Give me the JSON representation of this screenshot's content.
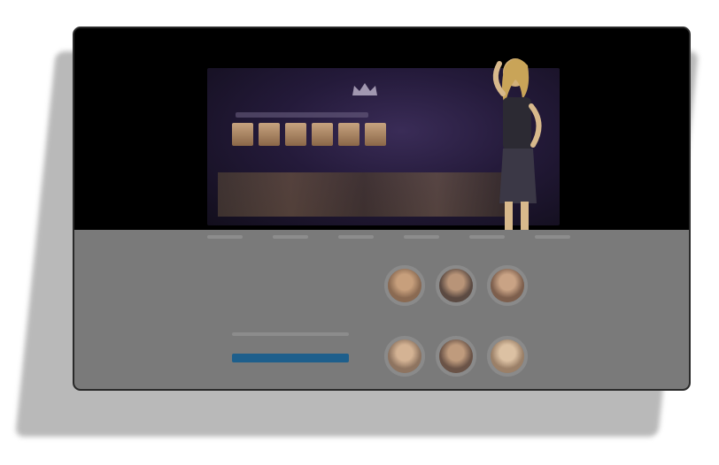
{
  "window": {
    "title_dots": [
      "close",
      "minimize",
      "zoom"
    ]
  },
  "hero": {
    "brand": "",
    "icons": {
      "logo": "crown-logo-icon"
    },
    "thumbnail_count": 6
  },
  "content": {
    "eyebrow": "",
    "heading": "",
    "cta_label": "",
    "avatars": [
      {
        "name": "avatar-1",
        "tone": "#8a6a52"
      },
      {
        "name": "avatar-2",
        "tone": "#5b4a42"
      },
      {
        "name": "avatar-3",
        "tone": "#7d5f4d"
      },
      {
        "name": "avatar-4",
        "tone": "#8e7460"
      },
      {
        "name": "avatar-5",
        "tone": "#6a5347"
      },
      {
        "name": "avatar-6",
        "tone": "#9b8068"
      }
    ]
  },
  "colors": {
    "accent": "#1e5f8c",
    "content_bg": "#7a7a7a",
    "hero_bg": "#000000"
  }
}
